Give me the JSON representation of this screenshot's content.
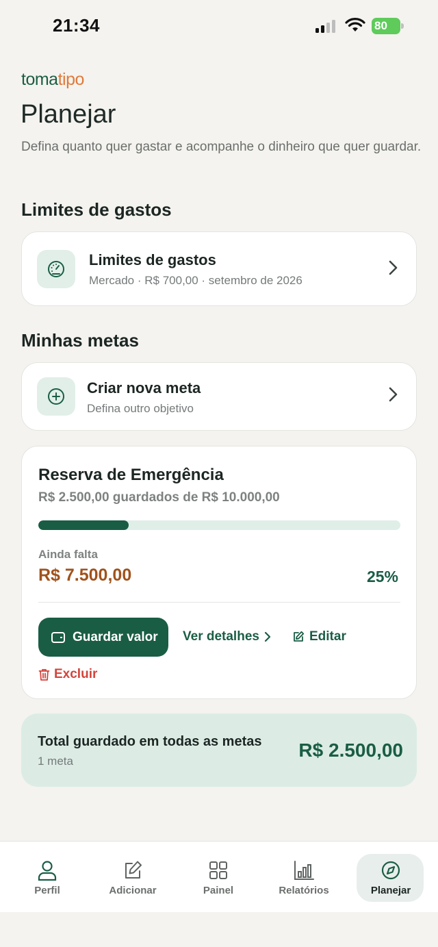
{
  "status_bar": {
    "time": "21:34",
    "battery": "80"
  },
  "brand": {
    "part1": "toma",
    "part2": "tipo"
  },
  "page": {
    "title": "Planejar",
    "subtitle": "Defina quanto quer gastar e acompanhe o dinheiro que quer guardar."
  },
  "limits_section": {
    "title": "Limites de gastos",
    "card": {
      "title": "Limites de gastos",
      "subtitle": "Mercado · R$ 700,00 · setembro de 2026",
      "icon": "gauge-icon"
    }
  },
  "goals_section": {
    "title": "Minhas metas",
    "new_goal": {
      "title": "Criar nova meta",
      "subtitle": "Defina outro objetivo",
      "icon": "plus-circle-icon"
    },
    "goal": {
      "title": "Reserva de Emergência",
      "subtitle": "R$ 2.500,00 guardados de R$ 10.000,00",
      "progress": 0.25,
      "remaining_label": "Ainda falta",
      "remaining_value": "R$ 7.500,00",
      "percent_label": "25%",
      "save_label": "Guardar valor",
      "details_label": "Ver detalhes",
      "edit_label": "Editar",
      "delete_label": "Excluir"
    }
  },
  "total": {
    "label": "Total guardado em todas as metas",
    "count": "1 meta",
    "value": "R$ 2.500,00"
  },
  "nav": [
    {
      "label": "Perfil",
      "icon": "user-icon"
    },
    {
      "label": "Adicionar",
      "icon": "edit-icon"
    },
    {
      "label": "Painel",
      "icon": "grid-icon"
    },
    {
      "label": "Relatórios",
      "icon": "bar-chart-icon"
    },
    {
      "label": "Planejar",
      "icon": "compass-icon",
      "active": true
    }
  ],
  "colors": {
    "primary": "#1a5d45",
    "accent_orange": "#e07a3a",
    "remaining": "#a0521c",
    "danger": "#d3443b",
    "background": "#f4f3ef"
  }
}
